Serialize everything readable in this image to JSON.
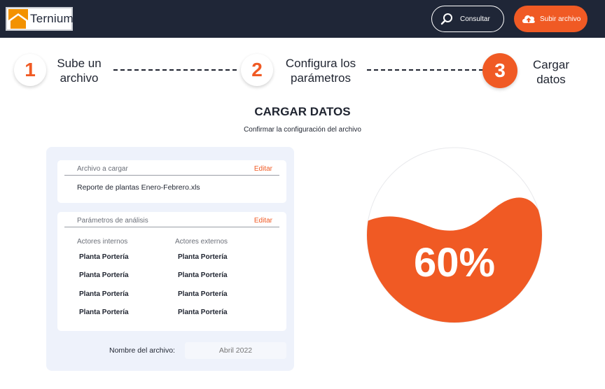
{
  "header": {
    "logo_text": "Ternium",
    "consult_label": "Consultar",
    "upload_label": "Subir archivo"
  },
  "stepper": [
    {
      "number": "1",
      "line1": "Sube un",
      "line2": "archivo"
    },
    {
      "number": "2",
      "line1": "Configura los",
      "line2": "parámetros"
    },
    {
      "number": "3",
      "line1": "Cargar",
      "line2": "datos"
    }
  ],
  "main": {
    "title": "CARGAR DATOS",
    "subtitle": "Confirmar la configuración del archivo"
  },
  "file_card": {
    "heading": "Archivo a cargar",
    "edit": "Editar",
    "file_name": "Reporte de plantas Enero-Febrero.xls"
  },
  "params_card": {
    "heading": "Parámetros de análisis",
    "edit": "Editar",
    "internal_header": "Actores internos",
    "external_header": "Actores externos",
    "internal": [
      "Planta Portería",
      "Planta Portería",
      "Planta Portería",
      "Planta Portería"
    ],
    "external": [
      "Planta Portería",
      "Planta Portería",
      "Planta Portería",
      "Planta Portería"
    ]
  },
  "file_name_field": {
    "label": "Nombre del archivo:",
    "placeholder": "Abril 2022"
  },
  "progress": {
    "value": 0.6,
    "text": "60%",
    "color": "#f05a24"
  },
  "colors": {
    "accent": "#f05a24",
    "header_bg": "#1f2637"
  }
}
